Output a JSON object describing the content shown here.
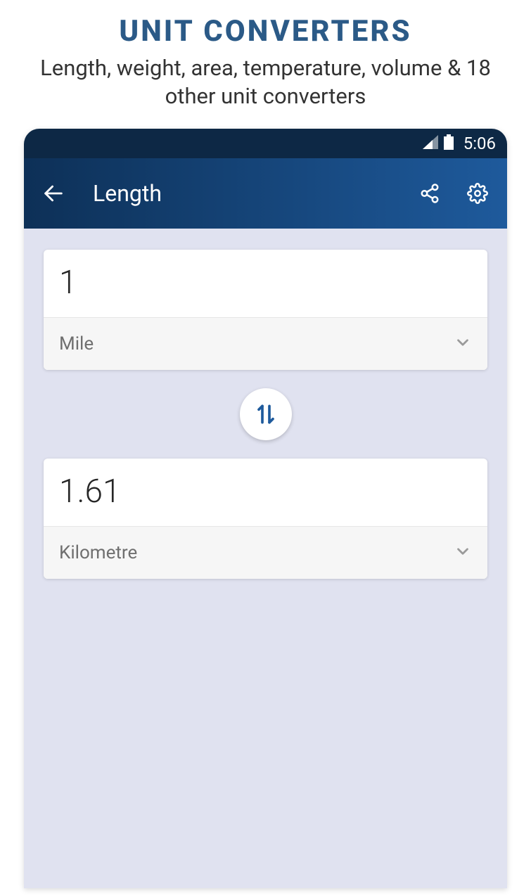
{
  "promo": {
    "title": "UNIT CONVERTERS",
    "subtitle": "Length, weight, area, temperature, volume & 18 other unit converters"
  },
  "status": {
    "time": "5:06"
  },
  "appbar": {
    "title": "Length"
  },
  "converter": {
    "from": {
      "value": "1",
      "unit": "Mile"
    },
    "to": {
      "value": "1.61",
      "unit": "Kilometre"
    }
  }
}
